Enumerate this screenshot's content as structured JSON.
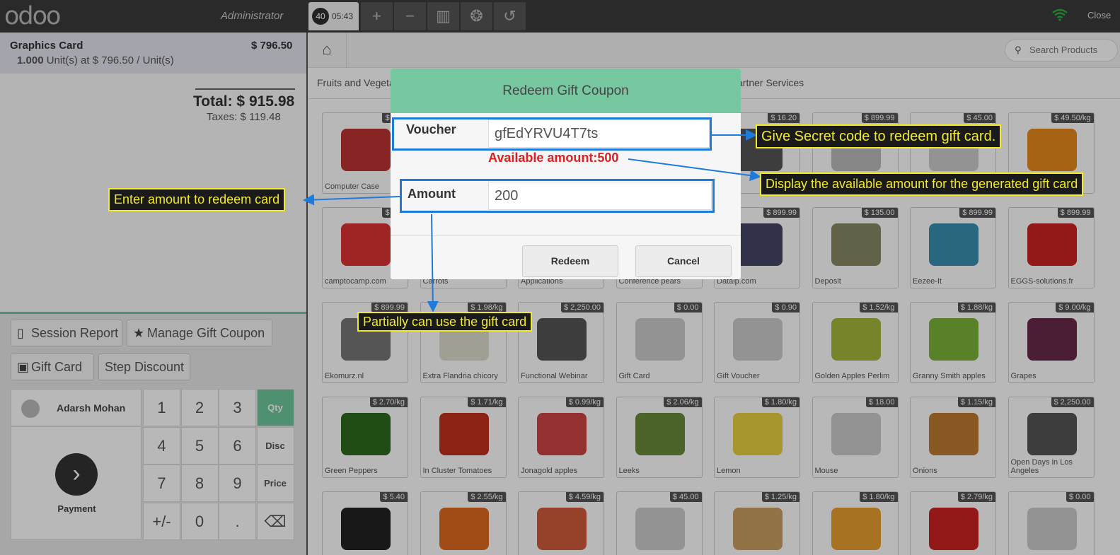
{
  "topbar": {
    "logo": "odoo",
    "user": "Administrator",
    "order_number": "40",
    "order_time": "05:43",
    "close_label": "Close",
    "buttons": [
      {
        "icon": "plus-icon",
        "glyph": "+"
      },
      {
        "icon": "minus-icon",
        "glyph": "−"
      },
      {
        "icon": "chart-icon",
        "glyph": "▥"
      },
      {
        "icon": "coins-icon",
        "glyph": "❂"
      },
      {
        "icon": "history-icon",
        "glyph": "↺"
      }
    ]
  },
  "order": {
    "line_name": "Graphics Card",
    "line_price": "$ 796.50",
    "line_detail_qty": "1.000",
    "line_detail_rest": "Unit(s) at $ 796.50 / Unit(s)",
    "total": "Total: $ 915.98",
    "taxes": "Taxes: $ 119.48"
  },
  "controls": {
    "session_report": "Session Report",
    "manage_gift_coupon": "Manage Gift Coupon",
    "gift_card": "Gift Card",
    "step_discount": "Step Discount"
  },
  "customer": {
    "name": "Adarsh Mohan"
  },
  "payment": {
    "label": "Payment"
  },
  "numpad": {
    "keys": [
      "1",
      "2",
      "3",
      "Qty",
      "4",
      "5",
      "6",
      "Disc",
      "7",
      "8",
      "9",
      "Price",
      "+/-",
      "0",
      "."
    ],
    "backspace_icon": "backspace-icon"
  },
  "products_header": {
    "search_placeholder": "Search Products",
    "categories": [
      "Fruits and Vegeta",
      "artner Services"
    ]
  },
  "products": [
    {
      "name": "Computer Case",
      "price": "$ 180"
    },
    {
      "name": "",
      "price": ""
    },
    {
      "name": "",
      "price": ""
    },
    {
      "name": "",
      "price": ""
    },
    {
      "name": "aneou",
      "price": "$ 16.20"
    },
    {
      "name": "",
      "price": "$ 899.99"
    },
    {
      "name": "",
      "price": "$ 45.00"
    },
    {
      "name": "",
      "price": "$ 49.50/kg"
    },
    {
      "name": "camptocamp.com",
      "price": "$ 899"
    },
    {
      "name": "Carrots",
      "price": ""
    },
    {
      "name": "Applications",
      "price": ""
    },
    {
      "name": "Conference pears",
      "price": ""
    },
    {
      "name": "Datalp.com",
      "price": "$ 899.99"
    },
    {
      "name": "Deposit",
      "price": "$ 135.00"
    },
    {
      "name": "Eezee-It",
      "price": "$ 899.99"
    },
    {
      "name": "EGGS-solutions.fr",
      "price": "$ 899.99"
    },
    {
      "name": "Ekomurz.nl",
      "price": "$ 899.99"
    },
    {
      "name": "Extra Flandria chicory",
      "price": "$ 1.98/kg"
    },
    {
      "name": "Functional Webinar",
      "price": "$ 2,250.00"
    },
    {
      "name": "Gift Card",
      "price": "$ 0.00"
    },
    {
      "name": "Gift Voucher",
      "price": "$ 0.90"
    },
    {
      "name": "Golden Apples Perlim",
      "price": "$ 1.52/kg"
    },
    {
      "name": "Granny Smith apples",
      "price": "$ 1.88/kg"
    },
    {
      "name": "Grapes",
      "price": "$ 9.00/kg"
    },
    {
      "name": "Green Peppers",
      "price": "$ 2.70/kg"
    },
    {
      "name": "In Cluster Tomatoes",
      "price": "$ 1.71/kg"
    },
    {
      "name": "Jonagold apples",
      "price": "$ 0.99/kg"
    },
    {
      "name": "Leeks",
      "price": "$ 2.06/kg"
    },
    {
      "name": "Lemon",
      "price": "$ 1.80/kg"
    },
    {
      "name": "Mouse",
      "price": "$ 18.00"
    },
    {
      "name": "Onions",
      "price": "$ 1.15/kg"
    },
    {
      "name": "Open Days in Los Angeles",
      "price": "$ 2,250.00"
    },
    {
      "name": "",
      "price": "$ 5.40"
    },
    {
      "name": "",
      "price": "$ 2.55/kg"
    },
    {
      "name": "",
      "price": "$ 4.59/kg"
    },
    {
      "name": "",
      "price": "$ 45.00"
    },
    {
      "name": "",
      "price": "$ 1.25/kg"
    },
    {
      "name": "",
      "price": "$ 1.80/kg"
    },
    {
      "name": "",
      "price": "$ 2.79/kg"
    },
    {
      "name": "",
      "price": "$ 0.00"
    }
  ],
  "modal": {
    "title": "Redeem Gift Coupon",
    "voucher_label": "Voucher",
    "voucher_value": "gfEdYRVU4T7ts",
    "available": "Available amount:500",
    "amount_label": "Amount",
    "amount_value": "200",
    "redeem_button": "Redeem",
    "cancel_button": "Cancel"
  },
  "annotations": {
    "secret_code": "Give Secret code to redeem gift card.",
    "available_amount": "Display the available amount for the generated gift card",
    "enter_amount": "Enter amount to redeem card",
    "partial": "Partially can use the gift card"
  },
  "colors": {
    "accent_green": "#77c7a1",
    "annotation_yellow": "#f3ea27",
    "highlight_blue": "#1e7bdc",
    "available_red": "#e02020"
  }
}
